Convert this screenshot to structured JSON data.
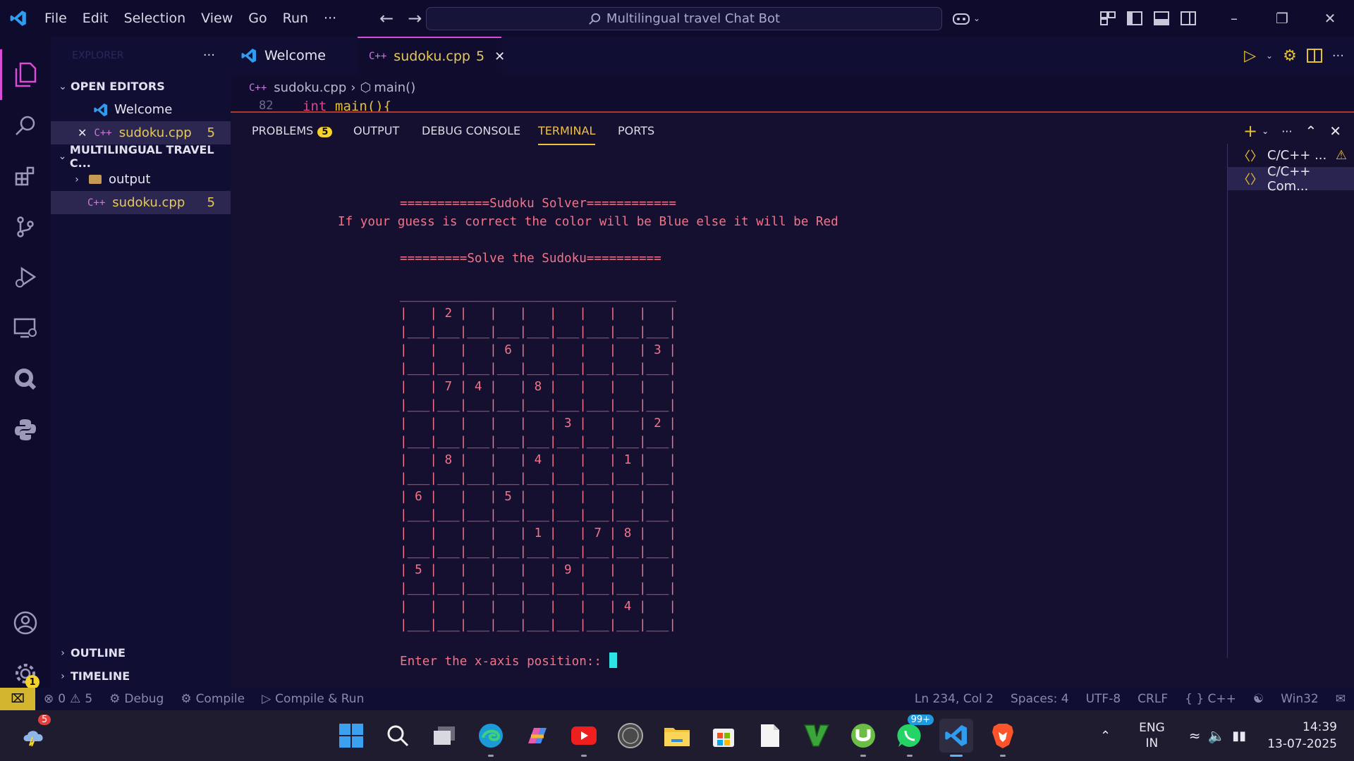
{
  "titlebar": {
    "menus": [
      "File",
      "Edit",
      "Selection",
      "View",
      "Go",
      "Run"
    ],
    "more": "···",
    "search_text": "Multilingual travel Chat Bot"
  },
  "sidebar": {
    "section_title": "EXPLORER",
    "more": "···",
    "open_editors_label": "OPEN EDITORS",
    "open_editors": [
      {
        "name": "Welcome",
        "count": ""
      },
      {
        "name": "sudoku.cpp",
        "count": "5"
      }
    ],
    "workspace_label": "MULTILINGUAL TRAVEL C...",
    "folder_output": "output",
    "file_sudoku": "sudoku.cpp",
    "file_sudoku_count": "5",
    "outline_label": "OUTLINE",
    "timeline_label": "TIMELINE",
    "cpp_badge": "C++"
  },
  "editor": {
    "tab_welcome": "Welcome",
    "tab_sudoku": "sudoku.cpp",
    "tab_sudoku_count": "5",
    "breadcrumb_file": "sudoku.cpp",
    "breadcrumb_symbol": "main()",
    "line_number": "82",
    "code_keyword": "int",
    "code_rest": "main(){"
  },
  "panel": {
    "tabs": [
      "PROBLEMS",
      "OUTPUT",
      "DEBUG CONSOLE",
      "TERMINAL",
      "PORTS"
    ],
    "problems_count": "5",
    "terminal_lines": {
      "title": "============Sudoku Solver============",
      "hint": "If your guess is correct the color will be Blue else it will be Red",
      "solve": "=========Solve the Sudoku==========",
      "prompt": "Enter the x-axis position:: "
    },
    "sudoku": [
      [
        "",
        "2",
        "",
        "",
        "",
        "",
        "",
        "",
        ""
      ],
      [
        "",
        "",
        "",
        "6",
        "",
        "",
        "",
        "",
        "3"
      ],
      [
        "",
        "7",
        "4",
        "",
        "8",
        "",
        "",
        "",
        ""
      ],
      [
        "",
        "",
        "",
        "",
        "",
        "3",
        "",
        "",
        "2"
      ],
      [
        "",
        "8",
        "",
        "",
        "4",
        "",
        "",
        "1",
        ""
      ],
      [
        "6",
        "",
        "",
        "5",
        "",
        "",
        "",
        "",
        ""
      ],
      [
        "",
        "",
        "",
        "",
        "1",
        "",
        "7",
        "8",
        ""
      ],
      [
        "5",
        "",
        "",
        "",
        "",
        "9",
        "",
        "",
        ""
      ],
      [
        "",
        "",
        "",
        "",
        "",
        "",
        "",
        "4",
        ""
      ]
    ],
    "terminal_list": [
      "C/C++ ...",
      "C/C++ Com..."
    ]
  },
  "statusbar": {
    "errors": "0",
    "warnings": "5",
    "debug": "Debug",
    "compile": "Compile",
    "compile_run": "Compile & Run",
    "position": "Ln 234, Col 2",
    "spaces": "Spaces: 4",
    "encoding": "UTF-8",
    "eol": "CRLF",
    "language": "{ } C++",
    "platform": "Win32"
  },
  "activity": {
    "settings_badge": "1"
  },
  "taskbar": {
    "weather_badge": "5",
    "whatsapp_badge": "99+",
    "lang_line1": "ENG",
    "lang_line2": "IN",
    "time": "14:39",
    "date": "13-07-2025"
  },
  "colors": {
    "terminal_text": "#f3738a",
    "accent": "#f0c040",
    "cursor": "#2ee3e3"
  }
}
